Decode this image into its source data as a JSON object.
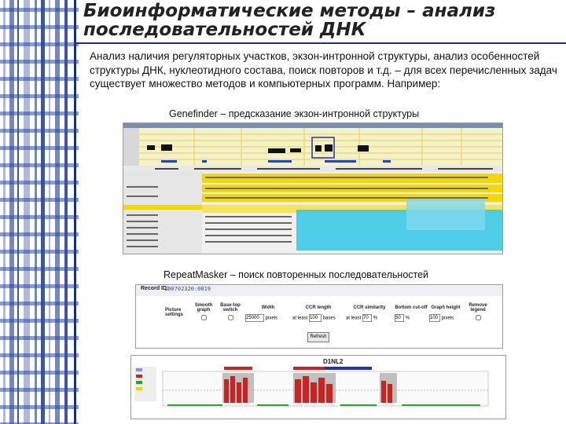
{
  "slide": {
    "title_line1": "Биоинформатические методы – анализ",
    "title_line2": "последовательностей ДНК",
    "intro": "Анализ наличия регуляторных участков, экзон-интронной структуры, анализ особенностей структуры ДНК, нуклеотидного состава, поиск повторов и т.д. – для всех перечисленных задач существует множество методов и компьютерных программ. Например:"
  },
  "genefinder": {
    "caption": "Genefinder – предсказание экзон-интронной структуры"
  },
  "repeatmasker": {
    "caption": "RepeatMasker – поиск повторенных последовательностей",
    "record_label": "Record ID:",
    "record_id": "100702320:0019",
    "form": {
      "row_label": "Picture settings",
      "columns": [
        "Smooth graph",
        "Base-top switch",
        "Width",
        "CCR length",
        "CCR similarity",
        "Bottom cut-off",
        "Graph height",
        "Remove legend"
      ],
      "width_value": "25000",
      "width_unit": "pixels",
      "ccr_length_prefix": "at least",
      "ccr_length_value": "100",
      "ccr_length_unit": "bases",
      "ccr_similarity_prefix": "at least",
      "ccr_similarity_value": "70",
      "ccr_similarity_unit": "%",
      "bottom_cutoff_value": "50",
      "bottom_cutoff_unit": "%",
      "graph_height_value": "100",
      "graph_height_unit": "pixels",
      "refresh_label": "Refresh"
    },
    "plot_label": "D1NL2"
  },
  "colors": {
    "sidebar_blue": "#1e3a8a",
    "title_rule": "#1a2f80",
    "genefinder_yellow": "#f5d800",
    "genefinder_cyan": "#33c7e6",
    "plot_red": "#cc2222",
    "plot_green": "#22aa22"
  }
}
